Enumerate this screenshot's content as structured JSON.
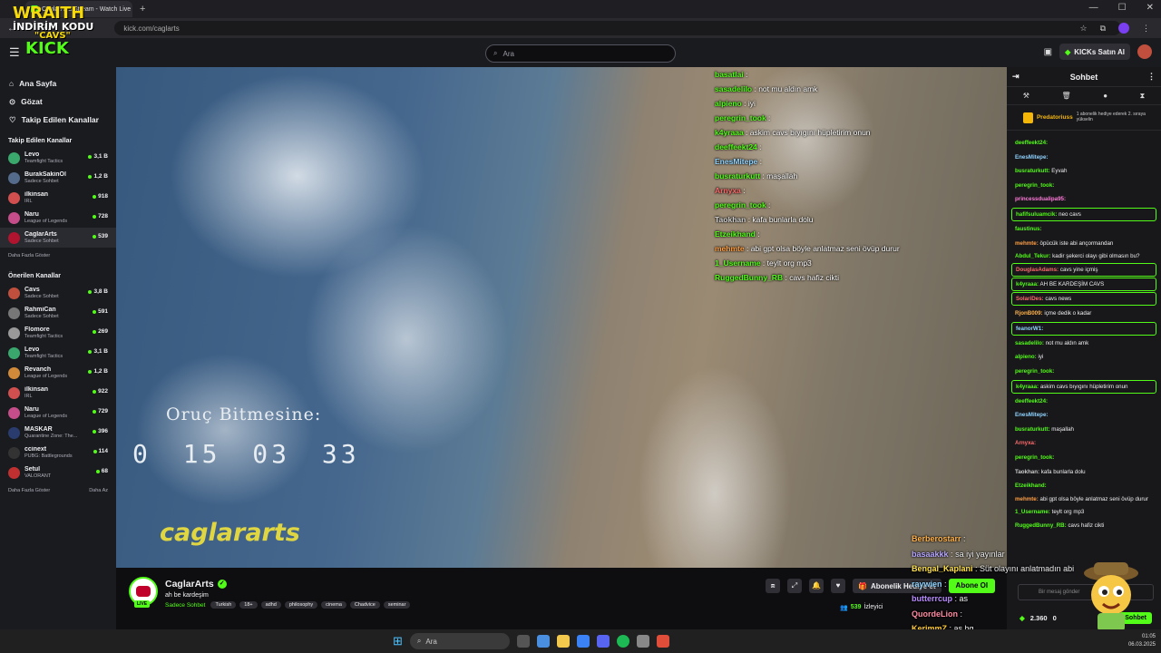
{
  "browser": {
    "tab_title": "CaglarArts Stream - Watch Live",
    "url": "kick.com/caglarts"
  },
  "overlay_logo": {
    "line1": "WRAITH",
    "line2": "İNDİRİM KODU",
    "line3": "\"CAVS\"",
    "line4": "KICK"
  },
  "header": {
    "search_placeholder": "Ara",
    "kicks_button": "KICKs Satın Al"
  },
  "sidebar": {
    "nav": [
      {
        "label": "Ana Sayfa",
        "icon": "home-icon"
      },
      {
        "label": "Gözat",
        "icon": "compass-icon"
      },
      {
        "label": "Takip Edilen Kanallar",
        "icon": "heart-icon"
      }
    ],
    "followed_title": "Takip Edilen Kanallar",
    "followed": [
      {
        "name": "Levo",
        "category": "Teamfight Tactics",
        "viewers": "3,1 B",
        "color": "#3aa76d"
      },
      {
        "name": "BurakSakinOl",
        "category": "Sadece Sohbet",
        "viewers": "1,2 B",
        "color": "#556b8c"
      },
      {
        "name": "ilkinsan",
        "category": "IRL",
        "viewers": "918",
        "color": "#d14f4f"
      },
      {
        "name": "Naru",
        "category": "League of Legends",
        "viewers": "728",
        "color": "#c44d8a"
      },
      {
        "name": "CaglarArts",
        "category": "Sadece Sohbet",
        "viewers": "539",
        "color": "#b1142e"
      }
    ],
    "show_more": "Daha Fazla Göster",
    "recommended_title": "Önerilen Kanallar",
    "recommended": [
      {
        "name": "Cavs",
        "category": "Sadece Sohbet",
        "viewers": "3,8 B",
        "color": "#c0503d"
      },
      {
        "name": "RahmiCan",
        "category": "Sadece Sohbet",
        "viewers": "591",
        "color": "#777777"
      },
      {
        "name": "Flomore",
        "category": "Teamfight Tactics",
        "viewers": "269",
        "color": "#999999"
      },
      {
        "name": "Levo",
        "category": "Teamfight Tactics",
        "viewers": "3,1 B",
        "color": "#3aa76d"
      },
      {
        "name": "Revanch",
        "category": "League of Legends",
        "viewers": "1,2 B",
        "color": "#d18a3a"
      },
      {
        "name": "ilkinsan",
        "category": "IRL",
        "viewers": "922",
        "color": "#d14f4f"
      },
      {
        "name": "Naru",
        "category": "League of Legends",
        "viewers": "729",
        "color": "#c44d8a"
      },
      {
        "name": "MASKAR",
        "category": "Quarantine Zone: The...",
        "viewers": "396",
        "color": "#2a3c6e"
      },
      {
        "name": "ccinext",
        "category": "PUBG: Battlegrounds",
        "viewers": "114",
        "color": "#333333"
      },
      {
        "name": "Setul",
        "category": "VALORANT",
        "viewers": "68",
        "color": "#c03030"
      }
    ],
    "show_more2": "Daha Fazla Göster",
    "show_less": "Daha Az"
  },
  "video": {
    "overlay_chat": [
      {
        "user": "basatlai",
        "text": "",
        "color": "#53fc18"
      },
      {
        "user": "sasadelilo",
        "text": "not mu aldın amk",
        "color": "#53fc18"
      },
      {
        "user": "alpieno",
        "text": "iyi",
        "color": "#53fc18"
      },
      {
        "user": "peregrin_took",
        "text": "",
        "color": "#53fc18"
      },
      {
        "user": "k4yraaa",
        "text": "askim cavs bıyıgını hüpletirim onun",
        "color": "#53fc18"
      },
      {
        "user": "deeffeekt24",
        "text": "",
        "color": "#53fc18"
      },
      {
        "user": "EnesMitepe",
        "text": "",
        "color": "#8fd3ff"
      },
      {
        "user": "busraturkutt",
        "text": "maşallah",
        "color": "#53fc18"
      },
      {
        "user": "Arnyxa",
        "text": "",
        "color": "#ff6b6b"
      },
      {
        "user": "peregrin_took",
        "text": "",
        "color": "#53fc18"
      },
      {
        "user": "Taokhan",
        "text": "kafa bunlarla dolu",
        "color": "#cccccc"
      },
      {
        "user": "Etzeikhand",
        "text": "",
        "color": "#53fc18"
      },
      {
        "user": "mehmte",
        "text": "abi gpt olsa böyle anlatmaz seni övüp durur",
        "color": "#ff9f43"
      },
      {
        "user": "1_Username",
        "text": "teylt org mp3",
        "color": "#53fc18"
      },
      {
        "user": "RuggedBunny_RB",
        "text": "cavs hafiz cikti",
        "color": "#53fc18"
      }
    ],
    "countdown_title": "Oruç Bitmesine:",
    "countdown": "0 15 03 33",
    "watermark": "caglararts"
  },
  "stream_info": {
    "channel": "CaglarArts",
    "live": "LIVE",
    "title": "ah be kardeşim",
    "category": "Sadece Sohbet",
    "tags": [
      "Turkish",
      "18+",
      "adhd",
      "philosophy",
      "cinema",
      "Chadvice",
      "seminar"
    ],
    "subscription_button": "Abonelik Hediye et",
    "follow_button": "Abone Ol",
    "viewers": "539",
    "viewers_label": "İzleyici"
  },
  "stream_overlay_chat": [
    {
      "user": "Berberostarr",
      "text": "",
      "cls": "u1"
    },
    {
      "user": "basaakkk",
      "text": "sa iyi yayınlar",
      "cls": "u2"
    },
    {
      "user": "Bengal_Kaplani",
      "text": "Süt olayını anlatmadın abi",
      "cls": "u3"
    },
    {
      "user": "raywien",
      "text": "",
      "cls": "u4"
    },
    {
      "user": "butterrcup",
      "text": "as",
      "cls": "u5"
    },
    {
      "user": "QuordeLion",
      "text": "",
      "cls": "u6"
    },
    {
      "user": "KerimmZ",
      "text": "as hg",
      "cls": "u7"
    }
  ],
  "chat": {
    "title": "Sohbet",
    "pinned_user": "Predatoriuss",
    "pinned_text": "1 abonelik hediye ederek 2. sıraya yükselin",
    "messages": [
      {
        "user": "deeffeekt24:",
        "text": "",
        "color": "#53fc18",
        "hl": false
      },
      {
        "user": "EnesMitepe:",
        "text": "",
        "color": "#8fd3ff",
        "hl": false
      },
      {
        "user": "busraturkutt:",
        "text": "Eyvah",
        "color": "#53fc18",
        "hl": false
      },
      {
        "user": "peregrin_took:",
        "text": "",
        "color": "#53fc18",
        "hl": false
      },
      {
        "user": "princessdualipa95:",
        "text": "",
        "color": "#ff7ad9",
        "hl": false
      },
      {
        "user": "hafifsuluamcik:",
        "text": "neo cavs",
        "color": "#53fc18",
        "hl": true
      },
      {
        "user": "faustinus:",
        "text": "",
        "color": "#53fc18",
        "hl": false
      },
      {
        "user": "mehmte:",
        "text": "öpücük iste abi ançormandan",
        "color": "#ff9f43",
        "hl": false
      },
      {
        "user": "Abdul_Tekur:",
        "text": "kadir şekerci olayı gibi olmasın bu?",
        "color": "#53fc18",
        "hl": false,
        "wrap": true
      },
      {
        "user": "DouglasAdams:",
        "text": "cavs yine içmiş",
        "color": "#ff6b6b",
        "hl": true
      },
      {
        "user": "k4yraaa:",
        "text": "AH BE KARDEŞİM CAVS",
        "color": "#53fc18",
        "hl": true
      },
      {
        "user": "SolariDes:",
        "text": "cavs news",
        "color": "#ff6b6b",
        "hl": true
      },
      {
        "user": "RjonB009:",
        "text": "içme dedik o kadar",
        "color": "#ffb24a",
        "hl": false
      },
      {
        "user": "feanorW1:",
        "text": "",
        "color": "#8fd3ff",
        "hl": true
      },
      {
        "user": "sasadelilo:",
        "text": "not mu aldın amk",
        "color": "#53fc18",
        "hl": false
      },
      {
        "user": "alpieno:",
        "text": "iyi",
        "color": "#53fc18",
        "hl": false
      },
      {
        "user": "peregrin_took:",
        "text": "",
        "color": "#53fc18",
        "hl": false
      },
      {
        "user": "k4yraaa:",
        "text": "askim cavs bıyıgını hüpletirim onun",
        "color": "#53fc18",
        "hl": true
      },
      {
        "user": "deeffeekt24:",
        "text": "",
        "color": "#53fc18",
        "hl": false
      },
      {
        "user": "EnesMitepe:",
        "text": "",
        "color": "#8fd3ff",
        "hl": false
      },
      {
        "user": "busraturkutt:",
        "text": "maşallah",
        "color": "#53fc18",
        "hl": false
      },
      {
        "user": "Arnyxa:",
        "text": "",
        "color": "#ff6b6b",
        "hl": false
      },
      {
        "user": "peregrin_took:",
        "text": "",
        "color": "#53fc18",
        "hl": false
      },
      {
        "user": "Taokhan:",
        "text": "kafa bunlarla dolu",
        "color": "#cccccc",
        "hl": false
      },
      {
        "user": "Etzeikhand:",
        "text": "",
        "color": "#53fc18",
        "hl": false
      },
      {
        "user": "mehmte:",
        "text": "abi gpt olsa böyle anlatmaz seni övüp durur",
        "color": "#ff9f43",
        "hl": false,
        "wrap": true
      },
      {
        "user": "1_Username:",
        "text": "teylt org mp3",
        "color": "#53fc18",
        "hl": false
      },
      {
        "user": "RuggedBunny_RB:",
        "text": "cavs hafiz cikti",
        "color": "#53fc18",
        "hl": false
      }
    ],
    "input_placeholder": "Bir mesaj gönder",
    "points": "2.360",
    "zero": "0",
    "send_button": "Sohbet"
  },
  "taskbar": {
    "search": "Ara",
    "clock": "01:05",
    "date": "06.03.2025"
  }
}
